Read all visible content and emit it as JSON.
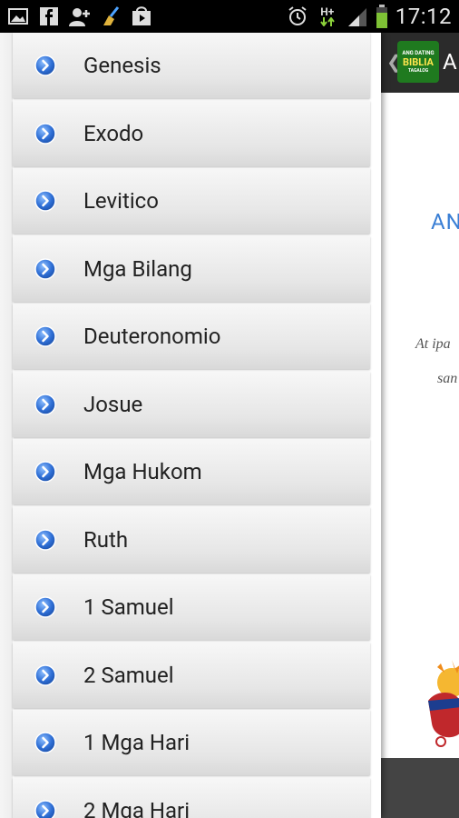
{
  "status_bar": {
    "time": "17:12",
    "network": "H+",
    "icons_left": [
      "image-icon",
      "facebook-icon",
      "add-contact-icon",
      "broom-icon",
      "shopping-bag-icon"
    ],
    "icons_right": [
      "alarm-icon",
      "data-arrows-icon",
      "signal-icon",
      "battery-icon"
    ]
  },
  "background_app": {
    "title_fragment": "A",
    "logo_lines": [
      "ANG DATING",
      "BIBLIA",
      "TAGALOG"
    ],
    "heading_fragment": "AN",
    "text_line_1": "At ipa",
    "text_line_2": "san"
  },
  "drawer": {
    "items": [
      {
        "label": "Genesis"
      },
      {
        "label": "Exodo"
      },
      {
        "label": "Levitico"
      },
      {
        "label": "Mga Bilang"
      },
      {
        "label": "Deuteronomio"
      },
      {
        "label": "Josue"
      },
      {
        "label": "Mga Hukom"
      },
      {
        "label": "Ruth"
      },
      {
        "label": "1 Samuel"
      },
      {
        "label": "2 Samuel"
      },
      {
        "label": "1 Mga Hari"
      },
      {
        "label": "2 Mga Hari"
      }
    ]
  },
  "colors": {
    "arrow_blue": "#2f6fd6",
    "logo_green": "#1f7a1f",
    "heading_blue": "#3a7fd5"
  }
}
